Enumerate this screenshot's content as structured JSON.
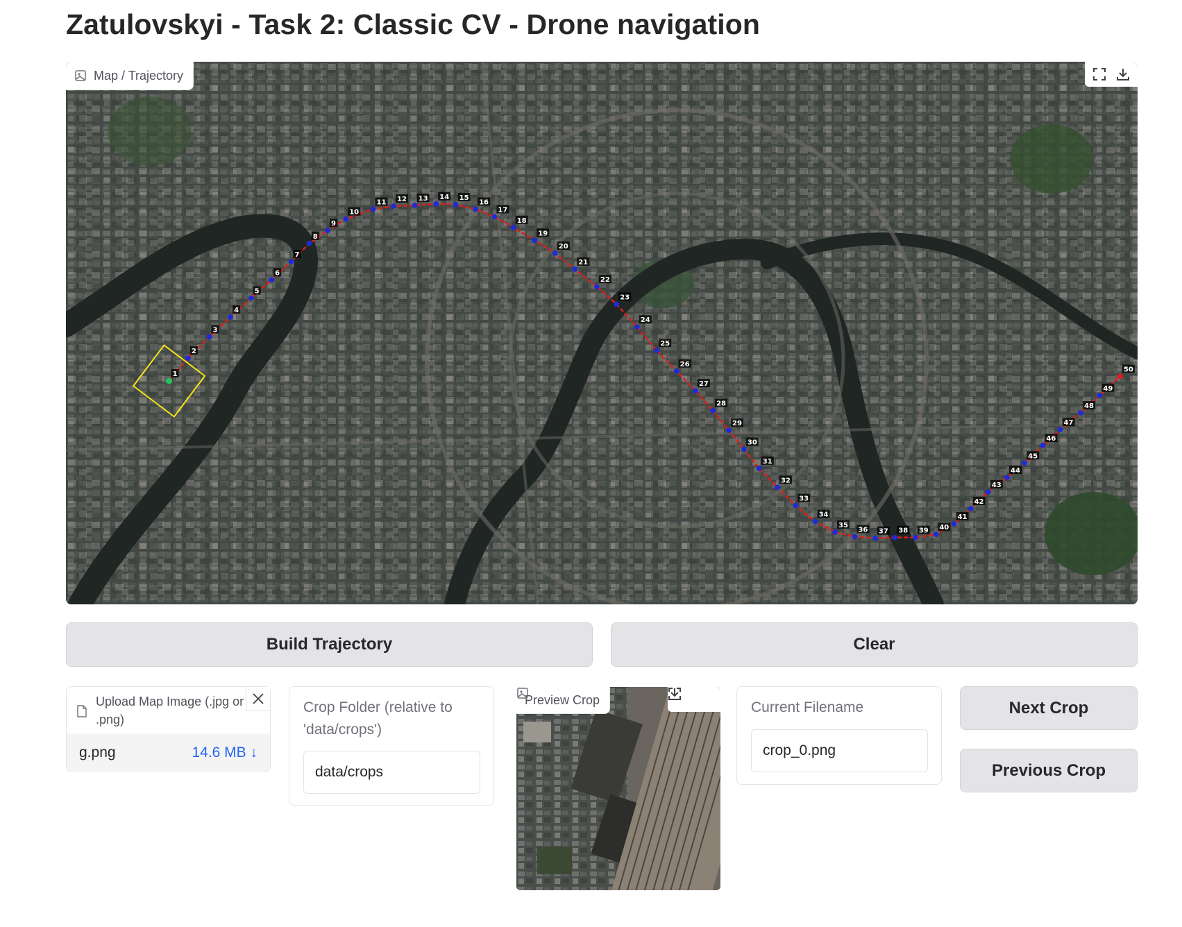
{
  "page": {
    "title": "Zatulovskyi - Task 2: Classic CV - Drone navigation"
  },
  "map": {
    "label": "Map / Trajectory",
    "label_icon": "image-icon",
    "tools": [
      "fullscreen-icon",
      "download-icon"
    ],
    "trajectory_points": [
      "1",
      "2",
      "3",
      "4",
      "5",
      "6",
      "7",
      "8",
      "9",
      "10",
      "11",
      "12",
      "13",
      "14",
      "15",
      "16",
      "17",
      "18",
      "19",
      "20",
      "21",
      "22",
      "23",
      "24",
      "25",
      "26",
      "27",
      "28",
      "29",
      "30",
      "31",
      "32",
      "33",
      "34",
      "35",
      "36",
      "37",
      "38",
      "39",
      "40",
      "41",
      "42",
      "43",
      "44",
      "45",
      "46",
      "47",
      "48",
      "49",
      "50"
    ],
    "colors": {
      "path": "#e11d1d",
      "point": "#1d2bd9",
      "start_point": "#22c55e",
      "current_view_frame": "#f5e51b",
      "last_point": "#e11d1d"
    }
  },
  "buttons": {
    "build": "Build Trajectory",
    "clear": "Clear",
    "next": "Next Crop",
    "previous": "Previous Crop"
  },
  "upload": {
    "label": "Upload Map Image (.jpg or .png)",
    "file_name": "g.png",
    "file_size": "14.6 MB ↓"
  },
  "crop_folder": {
    "label": "Crop Folder (relative to 'data/crops')",
    "value": "data/crops"
  },
  "preview": {
    "label": "Preview Crop",
    "tools": [
      "fullscreen-icon",
      "download-icon"
    ]
  },
  "current_filename": {
    "label": "Current Filename",
    "value": "crop_0.png"
  }
}
